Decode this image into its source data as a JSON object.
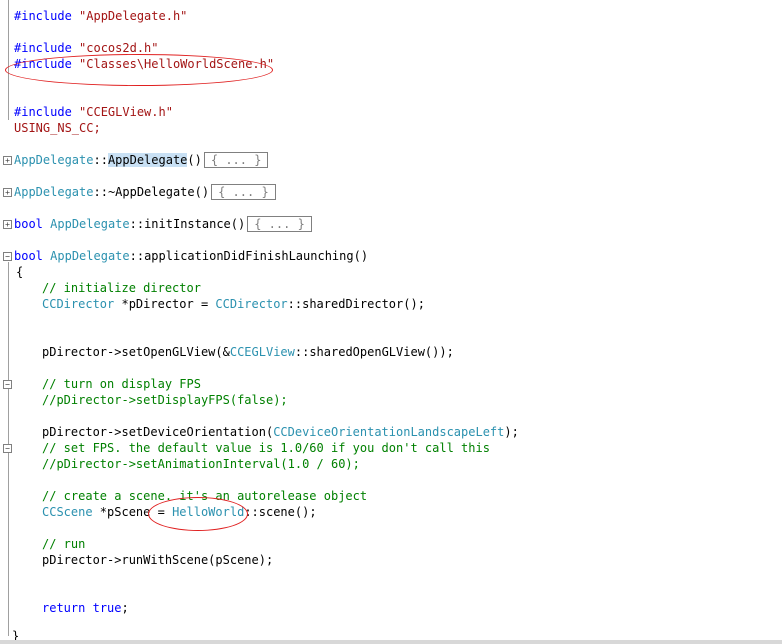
{
  "code": {
    "line1": {
      "kw": "#include",
      "str": "\"AppDelegate.h\""
    },
    "line2": {
      "kw": "#include",
      "str": "\"cocos2d.h\""
    },
    "line3": {
      "kw": "#include",
      "str": "\"Classes\\HelloWorldScene.h\""
    },
    "line4": {
      "kw": "#include",
      "str": "\"CCEGLView.h\""
    },
    "line5": "USING_NS_CC;",
    "ctor": {
      "cls": "AppDelegate",
      "sep": "::",
      "name": "AppDelegate",
      "parens": "()",
      "collapsed": "{ ... }"
    },
    "dtor": {
      "cls": "AppDelegate",
      "sep": "::",
      "name": "~AppDelegate()",
      "collapsed": "{ ... }"
    },
    "init": {
      "kw": "bool",
      "cls": "AppDelegate",
      "rest": "::initInstance()",
      "collapsed": "{ ... }"
    },
    "launch": {
      "kw": "bool",
      "cls": "AppDelegate",
      "rest": "::applicationDidFinishLaunching()"
    },
    "brace_open": "{",
    "c1": "// initialize director",
    "l_dir": {
      "type": "CCDirector",
      "mid": " *pDirector = ",
      "type2": "CCDirector",
      "rest": "::sharedDirector();"
    },
    "l_gl": {
      "pre": "pDirector->setOpenGLView(&",
      "type": "CCEGLView",
      "rest": "::sharedOpenGLView());"
    },
    "c2": "// turn on display FPS",
    "c3": "//pDirector->setDisplayFPS(false);",
    "l_orient": {
      "pre": "pDirector->setDeviceOrientation(",
      "type": "CCDeviceOrientationLandscapeLeft",
      "rest": ");"
    },
    "c4": "// set FPS. the default value is 1.0/60 if you don't call this",
    "c5": "//pDirector->setAnimationInterval(1.0 / 60);",
    "c6": "// create a scene. it's an autorelease object",
    "l_scene": {
      "type": "CCScene",
      "mid": " *pScene = ",
      "type2": "HelloWorld",
      "rest": "::scene();"
    },
    "c7": "// run",
    "l_run": "pDirector->runWithScene(pScene);",
    "l_ret": {
      "kw": "return",
      "val": "true",
      "end": ";"
    },
    "brace_close": "}"
  },
  "colors": {
    "keyword": "#0000ff",
    "string": "#a31515",
    "comment": "#008000",
    "type": "#2b91af",
    "annotation": "#e02020"
  },
  "icons": [
    "expand-plus-icon",
    "collapse-minus-icon"
  ]
}
